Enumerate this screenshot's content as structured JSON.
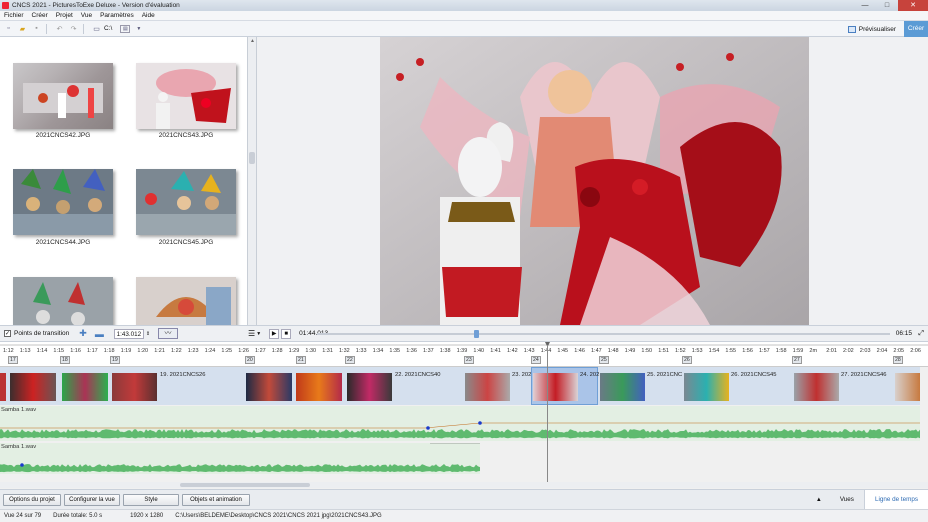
{
  "window": {
    "title": "CNCS 2021 - PicturesToExe Deluxe - Version d'évaluation",
    "minimize": "—",
    "maximize": "□",
    "close": "✕"
  },
  "menu": [
    "Fichier",
    "Créer",
    "Projet",
    "Vue",
    "Paramètres",
    "Aide"
  ],
  "toolbar": {
    "drive_label": "C:\\",
    "preview_label": "Prévisualiser",
    "create_label": "Créer"
  },
  "browser": {
    "files": [
      {
        "name": "2021CNCS42.JPG"
      },
      {
        "name": "2021CNCS43.JPG"
      },
      {
        "name": "2021CNCS44.JPG"
      },
      {
        "name": "2021CNCS45.JPG"
      },
      {
        "name": ""
      },
      {
        "name": ""
      }
    ]
  },
  "controls": {
    "transition_points_label": "Points de transition",
    "duration_value": "1:43.012",
    "current_time": "01:44.013",
    "total_time": "06:15",
    "checkbox_mark": "✓"
  },
  "ruler": {
    "ticks": [
      "1:12",
      "1:13",
      "1:14",
      "1:15",
      "1:16",
      "1:17",
      "1:18",
      "1:19",
      "1:20",
      "1:21",
      "1:22",
      "1:23",
      "1:24",
      "1:25",
      "1:26",
      "1:27",
      "1:28",
      "1:29",
      "1:30",
      "1:31",
      "1:32",
      "1:33",
      "1:34",
      "1:35",
      "1:36",
      "1:37",
      "1:38",
      "1:39",
      "1:40",
      "1:41",
      "1:42",
      "1:43",
      "1:44",
      "1:45",
      "1:46",
      "1:47",
      "1:48",
      "1:49",
      "1:50",
      "1:51",
      "1:52",
      "1:53",
      "1:54",
      "1:55",
      "1:56",
      "1:57",
      "1:58",
      "1:59",
      "2m",
      "2:01",
      "2:02",
      "2:03",
      "2:04",
      "2:05",
      "2:06"
    ],
    "slide_numbers": [
      "17",
      "18",
      "19",
      "20",
      "21",
      "22",
      "23",
      "24",
      "25",
      "26",
      "27",
      "28"
    ]
  },
  "timeline": {
    "slide_labels": [
      "19. 2021CNCS26",
      "22. 2021CNCS40",
      "23. 2021",
      "24. 202",
      "25. 2021CNC",
      "26. 2021CNCS45",
      "27. 2021CNCS46"
    ]
  },
  "audio": {
    "track1": "Samba 1.wav",
    "track2": "Samba 1.wav"
  },
  "bottom": {
    "buttons": [
      "Options du projet",
      "Configurer la vue",
      "Style",
      "Objets et animation"
    ],
    "tabs": [
      "Vues",
      "Ligne de temps"
    ],
    "active_tab": "Ligne de temps"
  },
  "status": {
    "position": "Vue 24 sur 79",
    "total": "Durée totale: 5.0 s",
    "resolution": "1920 x 1280",
    "path": "C:\\Users\\BELDEME\\Desktop\\CNCS 2021\\CNCS 2021 jpg\\2021CNCS43.JPG"
  }
}
